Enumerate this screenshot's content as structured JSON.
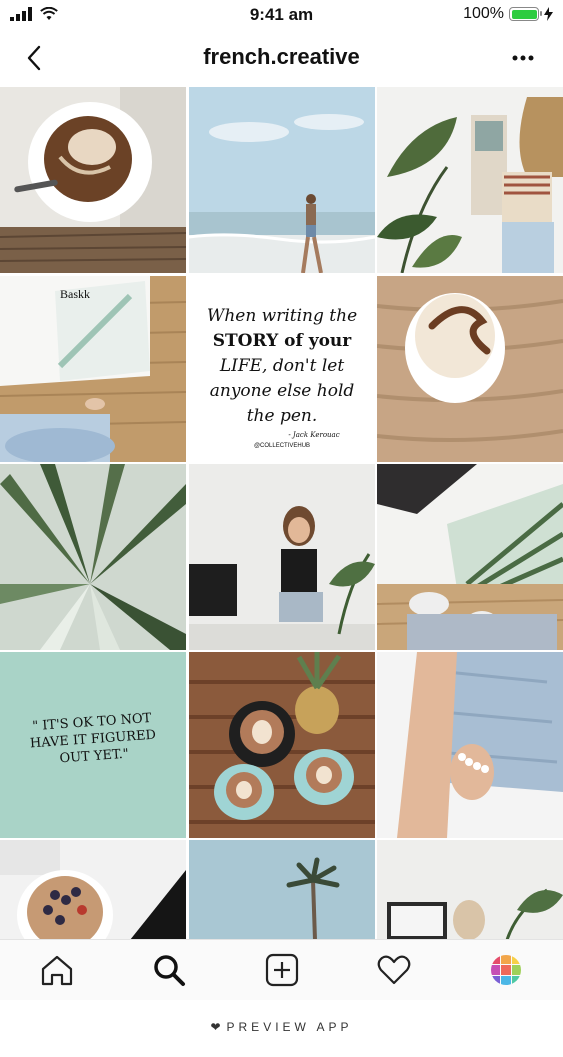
{
  "status": {
    "time": "9:41 am",
    "battery_text": "100%",
    "battery_level": 1.0
  },
  "header": {
    "title": "french.creative"
  },
  "grid": {
    "quote1": {
      "lines": [
        "When writing the",
        "STORY of your",
        "LIFE, don't let",
        "anyone else hold",
        "the pen."
      ],
      "author": "- Jack Kerouac",
      "handle": "@COLLECTIVEHUB"
    },
    "book_title": "Baskk",
    "quote2": {
      "lines": [
        "\" IT'S OK TO NOT",
        "HAVE IT FIGURED",
        "OUT YET.\""
      ]
    }
  },
  "tabs": [
    {
      "icon": "home-icon"
    },
    {
      "icon": "search-icon"
    },
    {
      "icon": "add-post-icon"
    },
    {
      "icon": "heart-icon"
    },
    {
      "icon": "preview-app-icon"
    }
  ],
  "footer": {
    "text": "PREVIEW APP"
  },
  "colors": {
    "accent_green": "#2ecc40",
    "mint": "#a9d3c7"
  }
}
